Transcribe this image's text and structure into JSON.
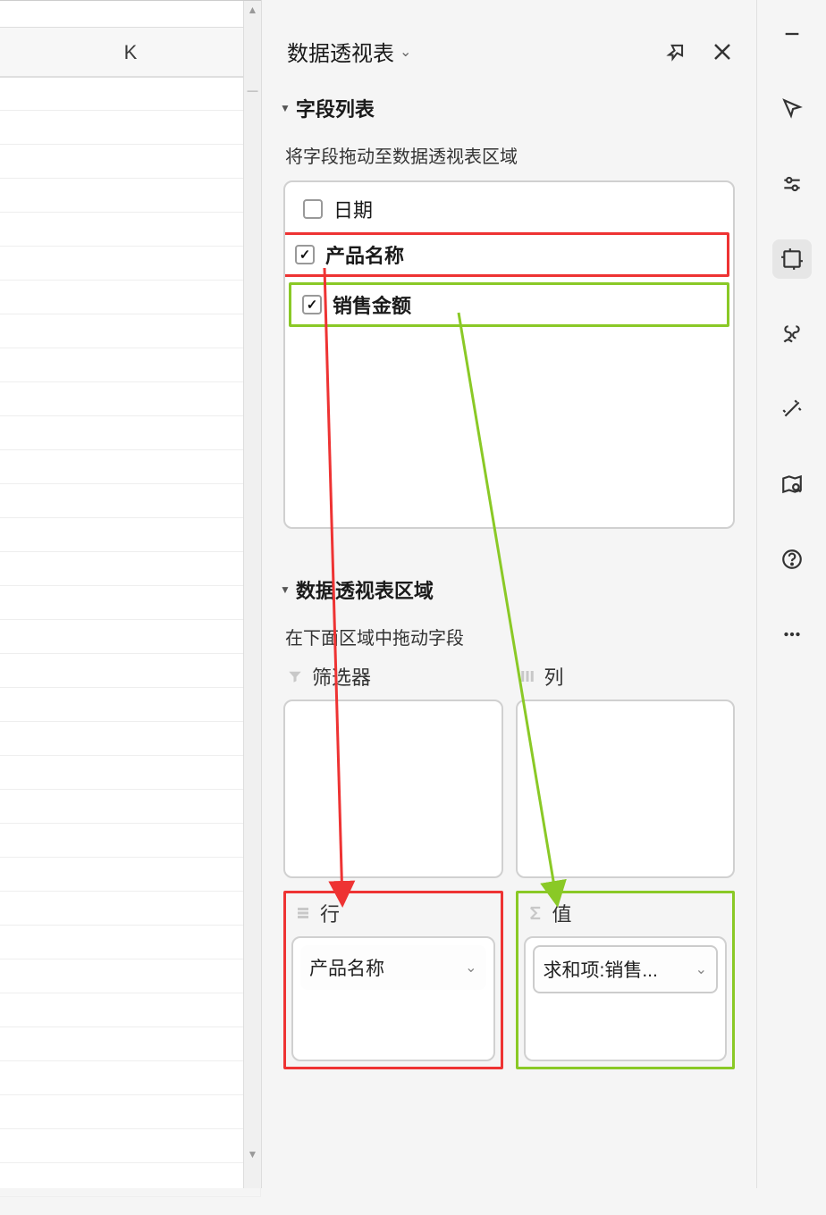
{
  "sheet": {
    "column_header": "K"
  },
  "panel": {
    "title": "数据透视表",
    "section_fields": {
      "title": "字段列表",
      "subtitle": "将字段拖动至数据透视表区域",
      "items": [
        {
          "label": "日期",
          "checked": false,
          "highlight": null
        },
        {
          "label": "产品名称",
          "checked": true,
          "highlight": "red"
        },
        {
          "label": "销售金额",
          "checked": true,
          "highlight": "green"
        }
      ]
    },
    "section_areas": {
      "title": "数据透视表区域",
      "subtitle": "在下面区域中拖动字段",
      "filter": {
        "label": "筛选器"
      },
      "columns": {
        "label": "列"
      },
      "rows": {
        "label": "行",
        "items": [
          "产品名称"
        ],
        "highlight": "red"
      },
      "values": {
        "label": "值",
        "items": [
          "求和项:销售..."
        ],
        "highlight": "green"
      }
    }
  },
  "sidebar_icons": [
    "minimize",
    "cursor",
    "sliders",
    "transform",
    "bind",
    "magic",
    "map-search",
    "help",
    "more"
  ]
}
